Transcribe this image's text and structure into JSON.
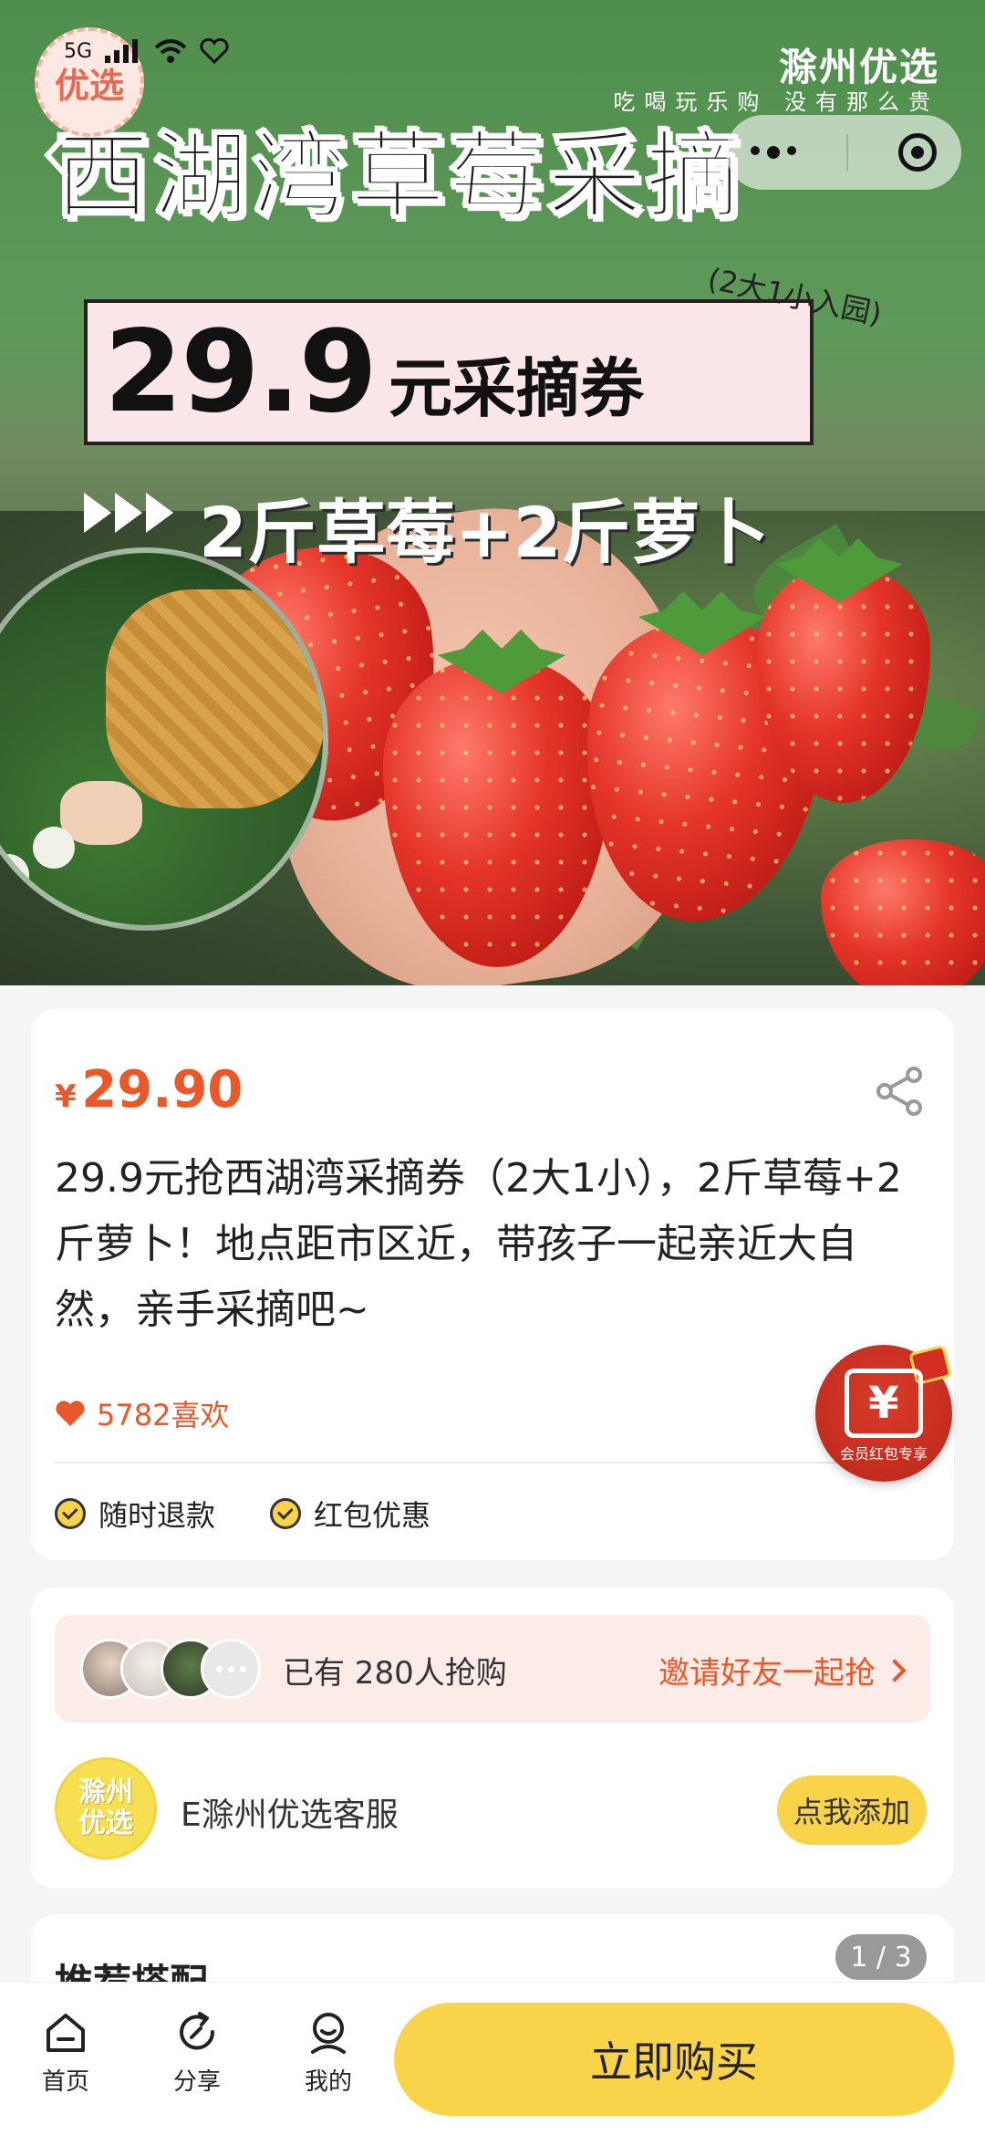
{
  "hero": {
    "title": "西湖湾草莓采摘",
    "price_big": "29.9",
    "price_rest": "元采摘券",
    "badge": "(2大1小入园)",
    "line3": "2斤草莓+2斤萝卜",
    "brand": "滁州优选",
    "slogan": "吃喝玩乐购 没有那么贵",
    "logo": "优选"
  },
  "status": {
    "signal": "5G"
  },
  "product": {
    "currency": "¥",
    "price": "29.90",
    "description": "29.9元抢西湖湾采摘券（2大1小），2斤草莓+2斤萝卜！地点距市区近，带孩子一起亲近大自然，亲手采摘吧~",
    "likes": "5782喜欢",
    "tags": [
      "随时退款",
      "红包优惠"
    ]
  },
  "redpack": {
    "symbol": "¥",
    "label": "会员红包专享"
  },
  "group": {
    "text": "已有 280人抢购",
    "invite": "邀请好友一起抢"
  },
  "service": {
    "logo": "滁州\n优选",
    "name": "E滁州优选客服",
    "add": "点我添加"
  },
  "recommend": {
    "title": "推荐搭配",
    "pager": "1 / 3"
  },
  "bottom": {
    "home": "首页",
    "share": "分享",
    "me": "我的",
    "buy": "立即购买"
  },
  "colors": {
    "accent": "#e8582a",
    "yellow": "#f9d34a",
    "green": "#4f8e4c"
  }
}
